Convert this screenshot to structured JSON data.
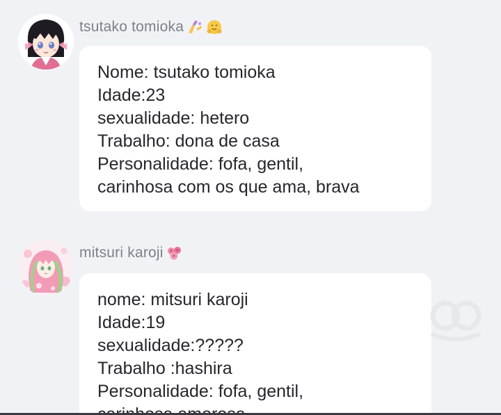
{
  "messages": [
    {
      "username": "tsutako tomioka",
      "emojis": [
        "nail-polish-icon",
        "hugging-face-icon"
      ],
      "lines": [
        "Nome: tsutako tomioka",
        "Idade:23",
        "sexualidade: hetero",
        "Trabalho: dona de casa",
        "Personalidade: fofa, gentil,",
        "carinhosa com os que ama, brava"
      ]
    },
    {
      "username": "mitsuri karoji",
      "emojis": [
        "flowers-icon"
      ],
      "lines": [
        "nome: mitsuri karoji",
        "Idade:19",
        "sexualidade:?????",
        "Trabalho :hashira",
        "Personalidade: fofa, gentil,",
        "carinhosa amorosa"
      ]
    }
  ],
  "colors": {
    "background": "#f1f2f6",
    "bubble": "#ffffff",
    "username": "#7f8088",
    "text": "#26262c"
  }
}
